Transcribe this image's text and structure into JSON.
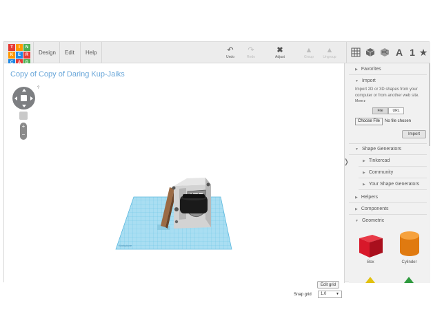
{
  "logo": {
    "letters": [
      "TIN",
      "KER",
      "CAD"
    ],
    "cells": [
      "T",
      "I",
      "N",
      "K",
      "E",
      "R",
      "C",
      "A",
      "D"
    ],
    "colors": [
      "#e53935",
      "#ff9800",
      "#4caf50",
      "#ff9800",
      "#1e88e5",
      "#e53935",
      "#1e88e5",
      "#e53935",
      "#4caf50"
    ]
  },
  "menu": {
    "design": "Design",
    "edit": "Edit",
    "help": "Help"
  },
  "toolbar": {
    "undo": "Undo",
    "undo_icon": "undo-icon",
    "redo": "Redo",
    "redo_icon": "redo-icon",
    "adjust": "Adjust",
    "adjust_icon": "adjust-icon",
    "group": "Group",
    "ungroup": "Ungroup"
  },
  "view": {
    "workplane_icon": "grid-icon",
    "box_icon": "cube-icon",
    "wire_icon": "wireframe-icon",
    "text_label": "A",
    "num_label": "1",
    "star_label": "★"
  },
  "design": {
    "title": "Copy of Copy of Daring Kup-Jaiks"
  },
  "navigation": {
    "help_label": "?",
    "zoom_in": "+",
    "zoom_out": "−"
  },
  "workplane": {
    "edit_grid": "Edit grid",
    "snap_label": "Snap grid",
    "snap_value": "1.0",
    "watermark": "Workplane"
  },
  "sidebar": {
    "favorites": "Favorites",
    "import": "Import",
    "import_desc": "Import 2D or 3D shapes from your computer or from another web site.",
    "more": "More ▸",
    "file_tab": "File",
    "url_tab": "URL",
    "choose_file": "Choose File",
    "no_file": "No file chosen",
    "import_button": "Import",
    "shape_generators": "Shape Generators",
    "tinkercad": "Tinkercad",
    "community": "Community",
    "your_generators": "Your Shape Generators",
    "helpers": "Helpers",
    "components": "Components",
    "geometric": "Geometric",
    "shapes": [
      {
        "name": "Box",
        "color": "#d8182a"
      },
      {
        "name": "Cylinder",
        "color": "#f08a1c"
      }
    ]
  },
  "colors": {
    "title_blue": "#6aa7d9",
    "grid_blue": "#8fd3ee",
    "grid_line": "#5cb8de"
  }
}
